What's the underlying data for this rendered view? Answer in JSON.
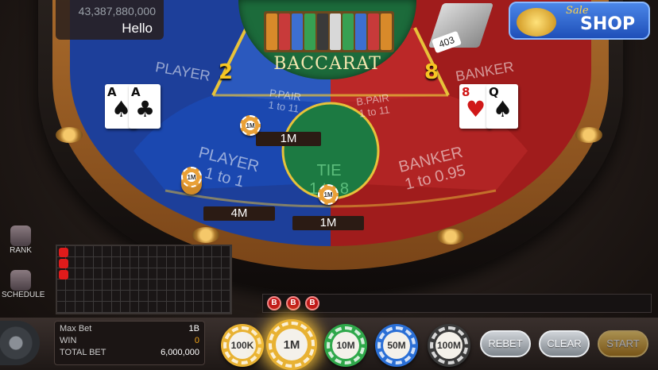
{
  "header": {
    "balance": "43,387,880,000",
    "greeting": "Hello"
  },
  "shop": {
    "sale_text": "Sale",
    "label": "SHOP"
  },
  "shoe": {
    "cards_left": "403"
  },
  "table": {
    "title": "BACCARAT",
    "player_score": "2",
    "banker_score": "8",
    "player_label": "PLAYER",
    "banker_label": "BANKER",
    "player_cards": [
      {
        "rank": "A",
        "suit": "♠"
      },
      {
        "rank": "A",
        "suit": "♣"
      }
    ],
    "banker_cards": [
      {
        "rank": "8",
        "suit": "♥"
      },
      {
        "rank": "Q",
        "suit": "♠"
      }
    ],
    "zones": {
      "p_pair": {
        "name": "P.PAIR",
        "payout": "1 to 11",
        "bet": "1M",
        "chip": "1M"
      },
      "b_pair": {
        "name": "B.PAIR",
        "payout": "1 to 11"
      },
      "player": {
        "name": "PLAYER",
        "payout": "1 to 1",
        "bet": "4M",
        "chip": "1M"
      },
      "tie": {
        "name": "TIE",
        "payout": "1 to 8",
        "bet": "1M",
        "chip": "1M"
      },
      "banker": {
        "name": "BANKER",
        "payout": "1 to 0.95"
      }
    }
  },
  "sidebar": {
    "rank_label": "RANK",
    "schedule_label": "SCHEDULE"
  },
  "history": {
    "results": [
      "B",
      "B",
      "B"
    ]
  },
  "stats": {
    "max_bet_label": "Max Bet",
    "max_bet": "1B",
    "win_label": "WIN",
    "win": "0",
    "total_bet_label": "TOTAL BET",
    "total_bet": "6,000,000"
  },
  "chips": [
    {
      "label": "100K",
      "color": "#e8b233",
      "selected": false
    },
    {
      "label": "1M",
      "color": "#e8b233",
      "selected": true
    },
    {
      "label": "10M",
      "color": "#2fa84a",
      "selected": false
    },
    {
      "label": "50M",
      "color": "#2a6fd6",
      "selected": false
    },
    {
      "label": "100M",
      "color": "#3a3a3a",
      "selected": false
    }
  ],
  "controls": {
    "rebet": "REBET",
    "clear": "CLEAR",
    "start": "START"
  },
  "colors": {
    "player_blue": "#1d3f9a",
    "banker_red": "#a01c1c",
    "tie_green": "#1c6b3b",
    "score_yellow": "#f7c623"
  }
}
